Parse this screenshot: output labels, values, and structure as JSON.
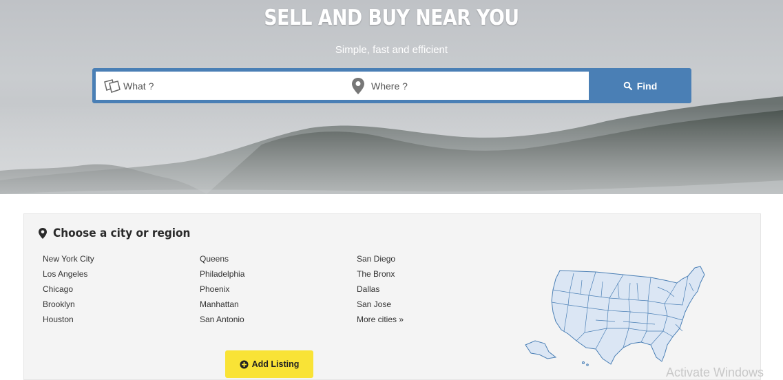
{
  "hero": {
    "title": "SELL AND BUY NEAR YOU",
    "subtitle": "Simple, fast and efficient"
  },
  "search": {
    "what_placeholder": "What ?",
    "where_placeholder": "Where ?",
    "find_label": "Find"
  },
  "regions": {
    "heading": "Choose a city or region",
    "columns": [
      [
        "New York City",
        "Los Angeles",
        "Chicago",
        "Brooklyn",
        "Houston"
      ],
      [
        "Queens",
        "Philadelphia",
        "Phoenix",
        "Manhattan",
        "San Antonio"
      ],
      [
        "San Diego",
        "The Bronx",
        "Dallas",
        "San Jose",
        "More cities »"
      ]
    ]
  },
  "add_listing_label": "Add Listing",
  "watermark": "Activate Windows",
  "colors": {
    "accent": "#4a7fb5",
    "add_button": "#f9e336",
    "map_fill": "#dbe6f4",
    "map_stroke": "#4a7fb5"
  },
  "icons": {
    "what": "tags-icon",
    "where": "map-marker-icon",
    "find": "search-icon",
    "region": "map-marker-icon",
    "add": "plus-circle-icon"
  }
}
